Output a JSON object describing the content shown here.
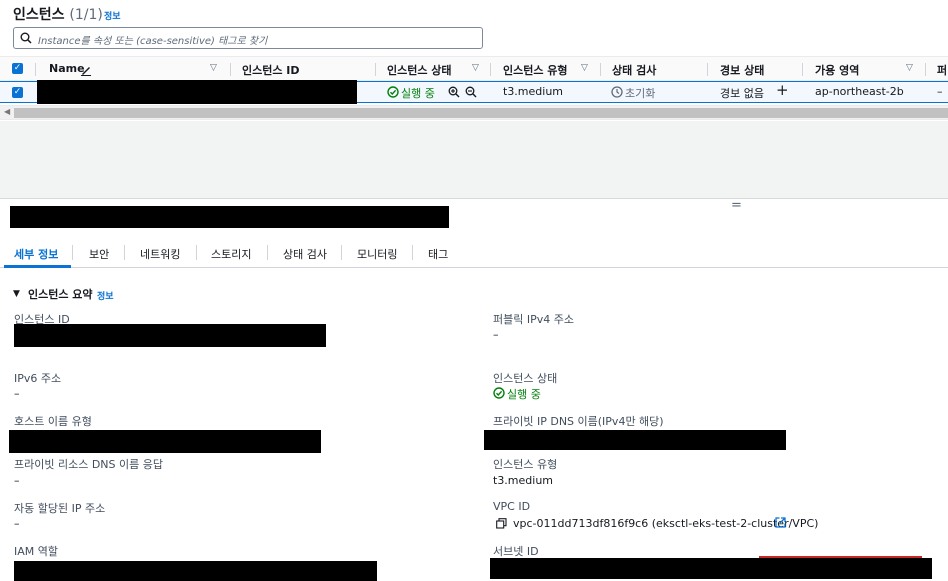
{
  "header": {
    "title": "인스턴스",
    "count": "(1/1)",
    "info": "정보"
  },
  "search": {
    "placeholder": "Instance를 속성 또는 (case-sensitive) 태그로 찾기"
  },
  "table": {
    "columns": [
      "Name",
      "인스턴스 ID",
      "인스턴스 상태",
      "인스턴스 유형",
      "상태 검사",
      "경보 상태",
      "가용 영역",
      "퍼"
    ],
    "row": {
      "state": "실행 중",
      "type": "t3.medium",
      "status_check": "초기화",
      "alarm": "경보 없음",
      "az": "ap-northeast-2b",
      "extra": "–"
    }
  },
  "detail": {
    "resize_handle": "="
  },
  "tabs": [
    "세부 정보",
    "보안",
    "네트워킹",
    "스토리지",
    "상태 검사",
    "모니터링",
    "태그"
  ],
  "summary": {
    "title": "인스턴스 요약",
    "info": "정보",
    "left": {
      "instance_id_label": "인스턴스 ID",
      "ipv6_label": "IPv6 주소",
      "ipv6_value": "–",
      "hostname_type_label": "호스트 이름 유형",
      "private_dns_label": "프라이빗 리소스 DNS 이름 응답",
      "private_dns_value": "–",
      "auto_ip_label": "자동 할당된 IP 주소",
      "auto_ip_value": "–",
      "iam_label": "IAM 역할"
    },
    "right": {
      "public_ipv4_label": "퍼블릭 IPv4 주소",
      "public_ipv4_value": "–",
      "state_label": "인스턴스 상태",
      "state_value": "실행 중",
      "private_ip_dns_label": "프라이빗 IP DNS 이름(IPv4만 해당)",
      "type_label": "인스턴스 유형",
      "type_value": "t3.medium",
      "vpc_label": "VPC ID",
      "vpc_value": "vpc-011dd713df816f9c6 (eksctl-eks-test-2-cluster/VPC)",
      "subnet_label": "서브넷 ID"
    }
  }
}
